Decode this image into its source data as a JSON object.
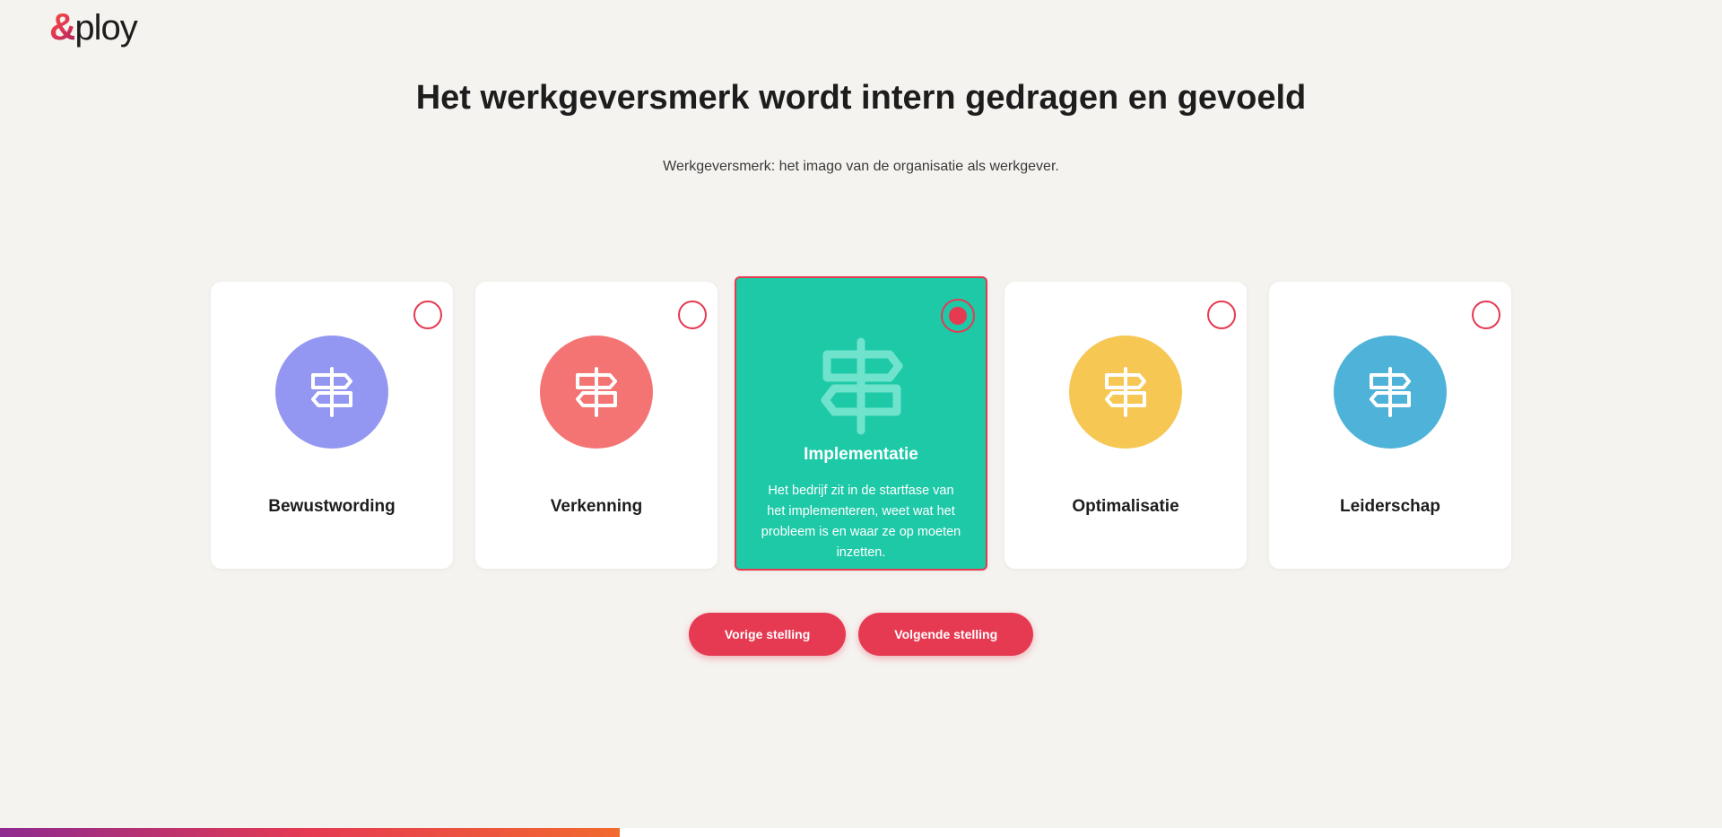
{
  "logo": {
    "amp": "&",
    "word": "ploy"
  },
  "title": "Het werkgeversmerk wordt intern gedragen en gevoeld",
  "subtitle": "Werkgeversmerk: het imago van de organisatie als werkgever.",
  "options": [
    {
      "label": "Bewustwording",
      "color": "#9497f2",
      "icon": "signpost-icon",
      "selected": false
    },
    {
      "label": "Verkenning",
      "color": "#f47473",
      "icon": "signpost-icon",
      "selected": false
    },
    {
      "label": "Implementatie",
      "color": "#1ec9a8",
      "icon": "signpost-icon",
      "selected": true,
      "description": "Het bedrijf zit in de startfase van het implementeren, weet wat het probleem is en waar ze op moeten inzetten."
    },
    {
      "label": "Optimalisatie",
      "color": "#f6c752",
      "icon": "signpost-icon",
      "selected": false
    },
    {
      "label": "Leiderschap",
      "color": "#4fb3d9",
      "icon": "signpost-icon",
      "selected": false
    }
  ],
  "buttons": {
    "prev": "Vorige stelling",
    "next": "Volgende stelling"
  },
  "accent_color": "#e63a52",
  "progress": 0.36
}
